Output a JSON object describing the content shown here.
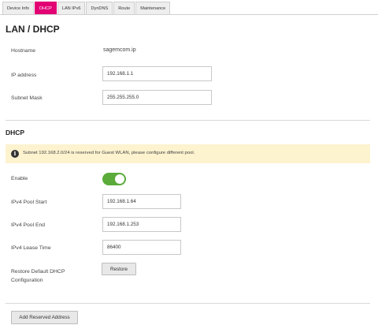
{
  "tabs": [
    {
      "label": "Device Info",
      "active": false
    },
    {
      "label": "DHCP",
      "active": true
    },
    {
      "label": "LAN IPv6",
      "active": false
    },
    {
      "label": "DynDNS",
      "active": false
    },
    {
      "label": "Route",
      "active": false
    },
    {
      "label": "Maintenance",
      "active": false
    }
  ],
  "lan": {
    "title": "LAN / DHCP",
    "hostname_label": "Hostname",
    "hostname_value": "sagemcom.ip",
    "ip_label": "IP address",
    "ip_value": "192.168.1.1",
    "mask_label": "Subnet Mask",
    "mask_value": "255.255.255.0"
  },
  "dhcp": {
    "title": "DHCP",
    "alert_icon": "info-icon",
    "alert_text": "Subnet 192.168.2.0/24 is reserved for Guest WLAN, please configure different pool.",
    "enable_label": "Enable",
    "enabled": true,
    "pool_start_label": "IPv4 Pool Start",
    "pool_start_value": "192.168.1.64",
    "pool_end_label": "IPv4 Pool End",
    "pool_end_value": "192.168.1.253",
    "lease_label": "IPv4 Lease Time",
    "lease_value": "86400",
    "restore_label_line1": "Restore Default DHCP",
    "restore_label_line2": "Configuration",
    "restore_button": "Restore",
    "add_reserved_button": "Add Reserved Address"
  },
  "colors": {
    "accent": "#e20074",
    "toggle_on": "#5aab3a",
    "alert_bg": "#fdf3cf"
  }
}
